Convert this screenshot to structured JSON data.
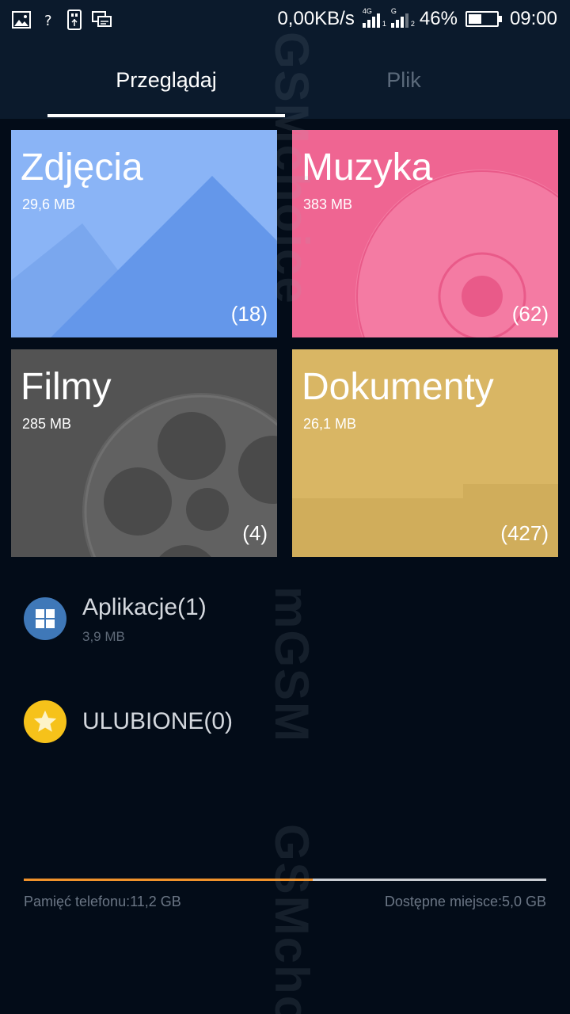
{
  "status_bar": {
    "network_speed": "0,00KB/s",
    "sim1_tag": "4G",
    "sim1_index": "1",
    "sim2_tag": "G",
    "sim2_index": "2",
    "battery_level": "46%",
    "battery_fraction": 0.46,
    "time": "09:00",
    "icons": [
      "image-icon",
      "help-icon",
      "usb-icon",
      "screen-mirror-icon"
    ]
  },
  "tabs": [
    {
      "label": "Przeglądaj",
      "active": true
    },
    {
      "label": "Plik",
      "active": false
    }
  ],
  "categories": [
    {
      "title": "Zdjęcia",
      "size": "29,6 MB",
      "count": "(18)",
      "color": "#8ab4f6"
    },
    {
      "title": "Muzyka",
      "size": "383 MB",
      "count": "(62)",
      "color": "#ef6592"
    },
    {
      "title": "Filmy",
      "size": "285 MB",
      "count": "(4)",
      "color": "#535353"
    },
    {
      "title": "Dokumenty",
      "size": "26,1 MB",
      "count": "(427)",
      "color": "#d9b664"
    }
  ],
  "list": {
    "apps": {
      "label": "Aplikacje(1)",
      "size": "3,9 MB",
      "icon": "apps-grid-icon",
      "color": "#3f78b8"
    },
    "favorites": {
      "label": "ULUBIONE(0)",
      "icon": "star-icon",
      "color": "#f6c21a"
    }
  },
  "storage": {
    "phone_label": "Pamięć telefonu:11,2 GB",
    "free_label": "Dostępne miejsce:5,0 GB",
    "used_fraction": 0.553,
    "used_color": "#f0922b",
    "track_color": "#c9cdd2"
  },
  "watermark": [
    "GSMchoice",
    "mGSM",
    "GSMcho"
  ]
}
